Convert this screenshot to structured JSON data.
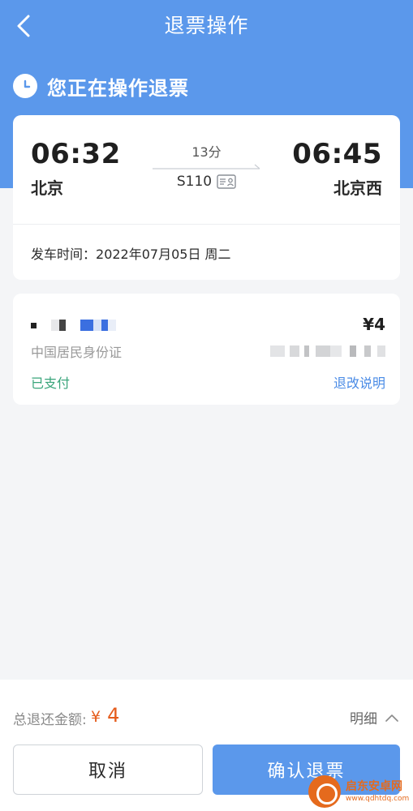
{
  "nav": {
    "title": "退票操作",
    "back_icon": "chevron-left-icon"
  },
  "status": {
    "text": "您正在操作退票",
    "icon": "clock-icon"
  },
  "train": {
    "departure_time": "06:32",
    "arrival_time": "06:45",
    "departure_station": "北京",
    "arrival_station": "北京西",
    "duration": "13分",
    "train_number": "S110",
    "train_badge_icon": "id-card-icon",
    "departure_date_label": "发车时间：",
    "departure_date": "2022年07月05日 周二"
  },
  "passenger": {
    "price": "¥4",
    "id_type": "中国居民身份证",
    "payment_status": "已支付",
    "rules_link": "退改说明"
  },
  "bottom": {
    "total_label": "总退还金额:",
    "total_currency": "¥",
    "total_amount": "4",
    "detail_label": "明细",
    "cancel_label": "取消",
    "confirm_label": "确认退票"
  },
  "colors": {
    "accent": "#5b98eb",
    "price": "#e55c1c",
    "paid": "#3aa57b",
    "link": "#4a8be6"
  },
  "watermark": {
    "name": "启东安卓网",
    "url": "www.qdhtdq.com"
  }
}
